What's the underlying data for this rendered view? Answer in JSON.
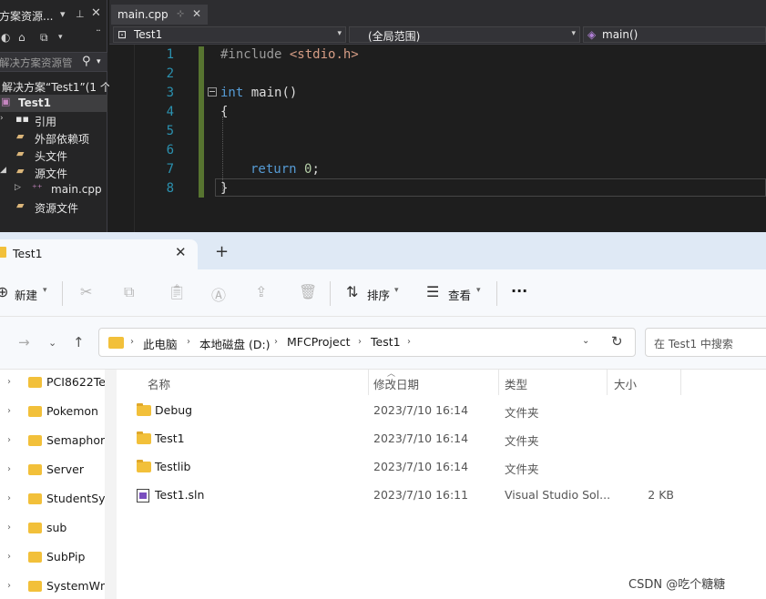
{
  "vs": {
    "solution_explorer": {
      "title": "方案资源...",
      "search_placeholder": "解决方案资源管",
      "tree": [
        {
          "label": "解决方案“Test1”(1 个",
          "indent": 0
        },
        {
          "label": "Test1",
          "selected": true
        },
        {
          "label": "引用"
        },
        {
          "label": "外部依赖项"
        },
        {
          "label": "头文件"
        },
        {
          "label": "源文件"
        },
        {
          "label": "main.cpp"
        },
        {
          "label": "资源文件"
        }
      ]
    },
    "tab": {
      "label": "main.cpp"
    },
    "nav": {
      "project": "Test1",
      "scope": "(全局范围)",
      "member": "main()"
    },
    "line_numbers": [
      "1",
      "2",
      "3",
      "4",
      "5",
      "6",
      "7",
      "8"
    ],
    "code": {
      "l1_pp": "#include",
      "l1_str": "<stdio.h>",
      "l3_kw": "int",
      "l3_rest": " main()",
      "l4": "{",
      "l7_kw": "return",
      "l7_num": "0",
      "l7_semi": ";",
      "l8": "}"
    }
  },
  "explorer": {
    "tab_label": "Test1",
    "toolbar": {
      "new_label": "新建",
      "sort_label": "排序",
      "view_label": "查看",
      "more": "···"
    },
    "breadcrumbs": [
      "此电脑",
      "本地磁盘 (D:)",
      "MFCProject",
      "Test1"
    ],
    "search_placeholder": "在 Test1 中搜索",
    "nav_items": [
      "PCI8622Te",
      "Pokemon",
      "Semaphor",
      "Server",
      "StudentSys",
      "sub",
      "SubPip",
      "SystemWn"
    ],
    "columns": {
      "name": "名称",
      "date": "修改日期",
      "type": "类型",
      "size": "大小"
    },
    "files": [
      {
        "name": "Debug",
        "date": "2023/7/10 16:14",
        "type": "文件夹",
        "size": "",
        "kind": "folder"
      },
      {
        "name": "Test1",
        "date": "2023/7/10 16:14",
        "type": "文件夹",
        "size": "",
        "kind": "folder"
      },
      {
        "name": "Testlib",
        "date": "2023/7/10 16:14",
        "type": "文件夹",
        "size": "",
        "kind": "folder"
      },
      {
        "name": "Test1.sln",
        "date": "2023/7/10 16:11",
        "type": "Visual Studio Sol...",
        "size": "2 KB",
        "kind": "sln"
      }
    ]
  },
  "watermark": "CSDN @吃个糖糖",
  "colors": {
    "vs_bg": "#1e1e1e",
    "keyword": "#569cd6",
    "line_number": "#2b91af",
    "folder": "#f2c03a"
  }
}
